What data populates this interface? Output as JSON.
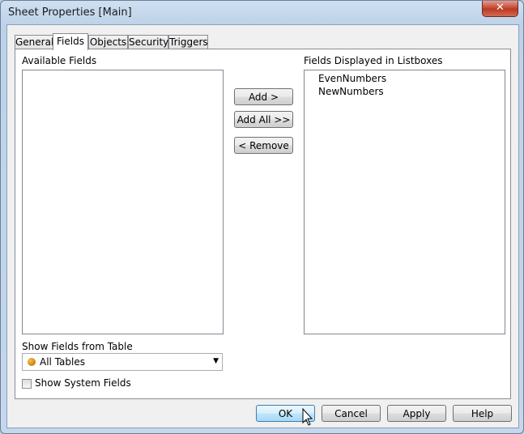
{
  "window": {
    "title": "Sheet Properties [Main]",
    "close_glyph": "✕"
  },
  "tabs": [
    {
      "label": "General"
    },
    {
      "label": "Fields",
      "active": true
    },
    {
      "label": "Objects"
    },
    {
      "label": "Security"
    },
    {
      "label": "Triggers"
    }
  ],
  "fields_tab": {
    "available_label": "Available Fields",
    "displayed_label": "Fields Displayed in Listboxes",
    "displayed_items": [
      "EvenNumbers",
      "NewNumbers"
    ],
    "add_button": "Add >",
    "add_all_button": "Add All >>",
    "remove_button": "< Remove",
    "show_fields_label": "Show Fields from Table",
    "table_select": {
      "value": "All Tables",
      "icon": "table-dot-icon"
    },
    "system_fields": {
      "label": "Show System Fields",
      "checked": false
    }
  },
  "footer": {
    "ok": "OK",
    "cancel": "Cancel",
    "apply": "Apply",
    "help": "Help"
  },
  "colors": {
    "accent": "#3c7fb1",
    "close": "#c3432e",
    "frame": "#bdd2e8"
  }
}
